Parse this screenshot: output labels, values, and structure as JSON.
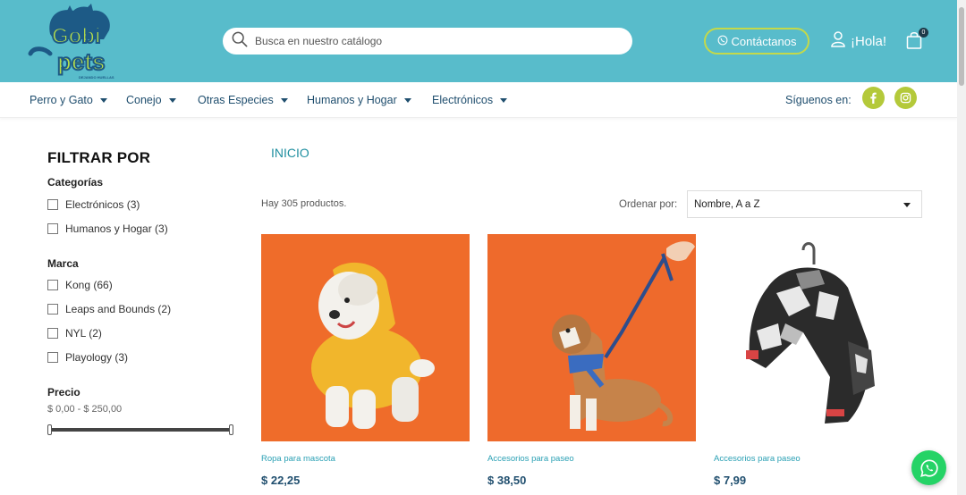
{
  "header": {
    "logo": {
      "brand_top": "Gobi",
      "brand_bottom": "pets",
      "tagline": "DEJANDO HUELLAS"
    },
    "search": {
      "placeholder": "Busca en nuestro catálogo"
    },
    "contact_label": "Contáctanos",
    "user_label": "¡Hola!",
    "cart_count": "0",
    "colors": {
      "bar": "#58bccb",
      "accent": "#c4d94a"
    }
  },
  "nav": {
    "items": [
      {
        "label": "Perro y Gato"
      },
      {
        "label": "Conejo"
      },
      {
        "label": "Otras Especies"
      },
      {
        "label": "Humanos y Hogar"
      },
      {
        "label": "Electrónicos"
      }
    ],
    "follow_label": "Síguenos en:",
    "social": [
      {
        "icon": "facebook-icon"
      },
      {
        "icon": "instagram-icon"
      }
    ]
  },
  "filters": {
    "title": "FILTRAR POR",
    "categories_title": "Categorías",
    "categories": [
      {
        "label": "Electrónicos (3)"
      },
      {
        "label": "Humanos y Hogar (3)"
      }
    ],
    "brand_title": "Marca",
    "brands": [
      {
        "label": "Kong (66)"
      },
      {
        "label": "Leaps and Bounds (2)"
      },
      {
        "label": "NYL (2)"
      },
      {
        "label": "Playology (3)"
      }
    ],
    "price_title": "Precio",
    "price_range": "$ 0,00 - $ 250,00",
    "price_slider": {
      "min": 0,
      "max": 250,
      "low": 0,
      "high": 250
    }
  },
  "main": {
    "breadcrumb": "INICIO",
    "product_count": "Hay 305 productos.",
    "sort_label": "Ordenar por:",
    "sort_value": "Nombre, A a Z",
    "products": [
      {
        "category": "Ropa para mascota",
        "price": "$ 22,25",
        "image": "dog-in-yellow-hoodie"
      },
      {
        "category": "Accesorios para paseo",
        "price": "$ 38,50",
        "image": "dog-with-harness-and-leash"
      },
      {
        "category": "Accesorios para paseo",
        "price": "$ 7,99",
        "image": "camouflage-harness"
      }
    ]
  },
  "whatsapp_icon": "whatsapp-icon"
}
